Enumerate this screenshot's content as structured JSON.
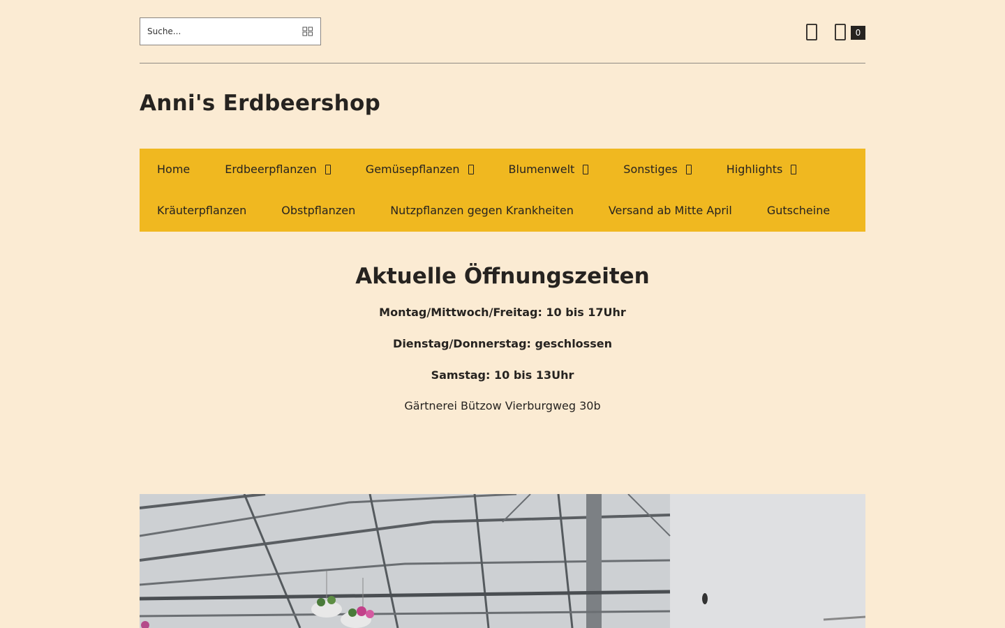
{
  "search": {
    "placeholder": "Suche..."
  },
  "header": {
    "cart_count": "0",
    "site_title": "Anni's Erdbeershop"
  },
  "nav": {
    "row1": [
      {
        "label": "Home",
        "has_dropdown": false
      },
      {
        "label": "Erdbeerpflanzen",
        "has_dropdown": true
      },
      {
        "label": "Gemüsepflanzen",
        "has_dropdown": true
      },
      {
        "label": "Blumenwelt",
        "has_dropdown": true
      },
      {
        "label": "Sonstiges",
        "has_dropdown": true
      },
      {
        "label": "Highlights",
        "has_dropdown": true
      }
    ],
    "row2": [
      {
        "label": "Kräuterpflanzen"
      },
      {
        "label": "Obstpflanzen"
      },
      {
        "label": "Nutzpflanzen gegen Krankheiten"
      },
      {
        "label": "Versand ab Mitte April"
      },
      {
        "label": "Gutscheine"
      }
    ]
  },
  "content": {
    "heading": "Aktuelle Öffnungszeiten",
    "line1": "Montag/Mittwoch/Freitag: 10 bis 17Uhr",
    "line2": "Dienstag/Donnerstag: geschlossen",
    "line3": "Samstag: 10 bis 13Uhr",
    "address": "Gärtnerei Bützow Vierburgweg 30b"
  },
  "colors": {
    "background": "#fbebd3",
    "nav_background": "#f0b820",
    "text": "#262320"
  },
  "icons": {
    "search": "search-icon",
    "user": "user-icon",
    "cart": "cart-icon",
    "dropdown": "chevron-down-icon"
  }
}
